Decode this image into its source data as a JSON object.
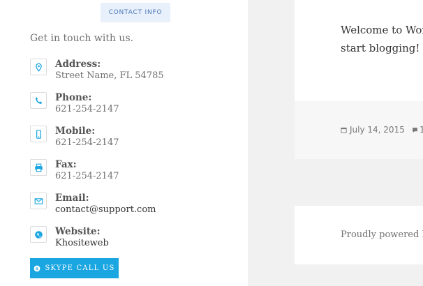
{
  "sidebar": {
    "widget_title": "Contact Info",
    "intro": "Get in touch with us.",
    "items": [
      {
        "label": "Address:",
        "value": "Street Name, FL 54785",
        "icon": "map-pin-icon"
      },
      {
        "label": "Phone:",
        "value": "621-254-2147",
        "icon": "phone-icon"
      },
      {
        "label": "Mobile:",
        "value": "621-254-2147",
        "icon": "mobile-icon"
      },
      {
        "label": "Fax:",
        "value": "621-254-2147",
        "icon": "printer-icon"
      },
      {
        "label": "Email:",
        "value": "contact@support.com",
        "icon": "envelope-icon"
      },
      {
        "label": "Website:",
        "value": "Khositeweb",
        "icon": "globe-icon"
      }
    ],
    "skype_button": "Skype Call Us"
  },
  "post": {
    "excerpt_line1": "Welcome to Wor",
    "excerpt_line2": "start blogging!",
    "date": "July 14, 2015",
    "comments": "1"
  },
  "footer": {
    "text": "Proudly powered b"
  },
  "colors": {
    "accent": "#1aa6e1",
    "title_bg": "#e8f0fb",
    "page_bg": "#f1f1f1"
  }
}
